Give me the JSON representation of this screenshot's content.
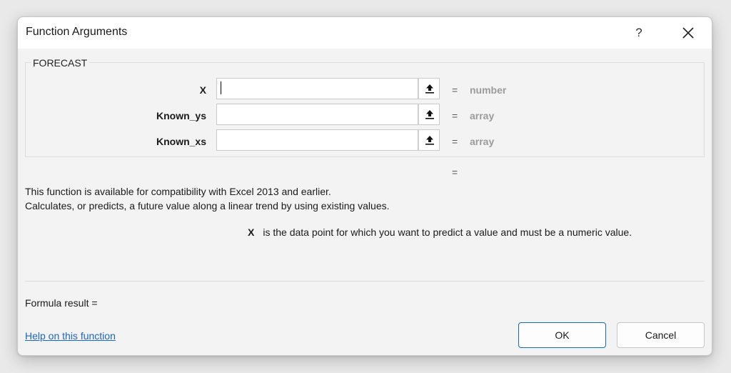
{
  "dialog": {
    "title": "Function Arguments",
    "help_symbol": "?",
    "function_name": "FORECAST",
    "arguments": [
      {
        "label": "X",
        "value": "",
        "result": "number"
      },
      {
        "label": "Known_ys",
        "value": "",
        "result": "array"
      },
      {
        "label": "Known_xs",
        "value": "",
        "result": "array"
      }
    ],
    "equals_sign": "=",
    "description_line1": "This function is available for compatibility with Excel 2013 and earlier.",
    "description_line2": "Calculates, or predicts, a future value along a linear trend by using existing values.",
    "arg_help_name": "X",
    "arg_help_text": "is the data point for which you want to predict a value and must be a numeric value.",
    "formula_result_label": "Formula result =",
    "help_link": "Help on this function",
    "ok_label": "OK",
    "cancel_label": "Cancel"
  },
  "colors": {
    "accent": "#0f6cbd",
    "link": "#1a66c9",
    "muted": "#9b9b9b"
  }
}
